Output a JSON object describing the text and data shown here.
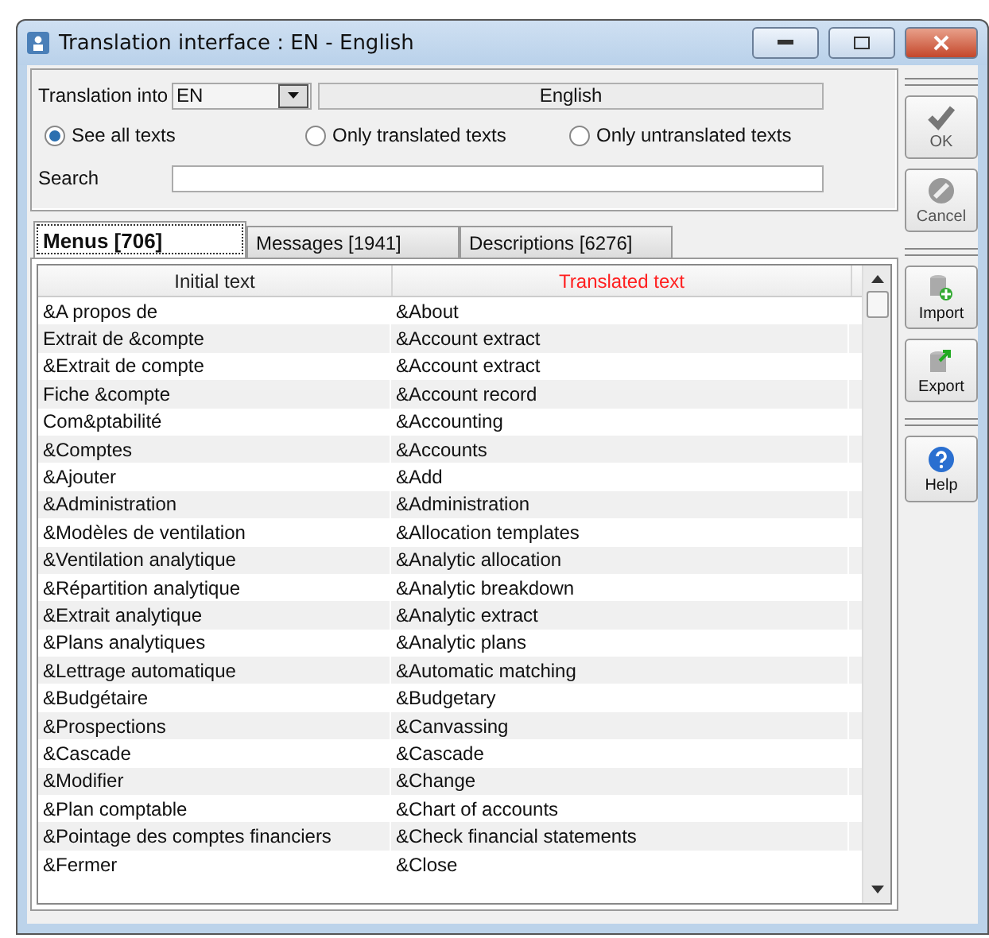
{
  "window": {
    "title": "Translation interface : EN - English"
  },
  "translation_into": {
    "label": "Translation into",
    "code": "EN",
    "name": "English"
  },
  "filters": [
    {
      "label": "See all texts",
      "selected": true
    },
    {
      "label": "Only translated texts",
      "selected": false
    },
    {
      "label": "Only untranslated texts",
      "selected": false
    }
  ],
  "search": {
    "label": "Search"
  },
  "tabs": [
    {
      "label": "Menus [706]",
      "selected": true
    },
    {
      "label": "Messages [1941]",
      "selected": false
    },
    {
      "label": "Descriptions [6276]",
      "selected": false
    }
  ],
  "table": {
    "columns": [
      {
        "label": "Initial text",
        "highlighted": false
      },
      {
        "label": "Translated text",
        "highlighted": true
      }
    ],
    "rows": [
      [
        "&A propos de",
        "&About"
      ],
      [
        "Extrait de &compte",
        "&Account extract"
      ],
      [
        "&Extrait de compte",
        "&Account extract"
      ],
      [
        "Fiche &compte",
        "&Account record"
      ],
      [
        "Com&ptabilité",
        "&Accounting"
      ],
      [
        "&Comptes",
        "&Accounts"
      ],
      [
        "&Ajouter",
        "&Add"
      ],
      [
        "&Administration",
        "&Administration"
      ],
      [
        "&Modèles de ventilation",
        "&Allocation templates"
      ],
      [
        "&Ventilation analytique",
        "&Analytic allocation"
      ],
      [
        "&Répartition analytique",
        "&Analytic breakdown"
      ],
      [
        "&Extrait analytique",
        "&Analytic extract"
      ],
      [
        "&Plans analytiques",
        "&Analytic plans"
      ],
      [
        "&Lettrage automatique",
        "&Automatic matching"
      ],
      [
        "&Budgétaire",
        "&Budgetary"
      ],
      [
        "&Prospections",
        "&Canvassing"
      ],
      [
        "&Cascade",
        "&Cascade"
      ],
      [
        "&Modifier",
        "&Change"
      ],
      [
        "&Plan comptable",
        "&Chart of accounts"
      ],
      [
        "&Pointage des comptes financiers",
        "&Check financial statements"
      ],
      [
        "&Fermer",
        "&Close"
      ]
    ]
  },
  "buttons": [
    {
      "kind": "ok",
      "label": "OK"
    },
    {
      "kind": "cancel",
      "label": "Cancel"
    },
    {
      "kind": "import",
      "label": "Import"
    },
    {
      "kind": "export",
      "label": "Export"
    },
    {
      "kind": "help",
      "label": "Help"
    }
  ]
}
